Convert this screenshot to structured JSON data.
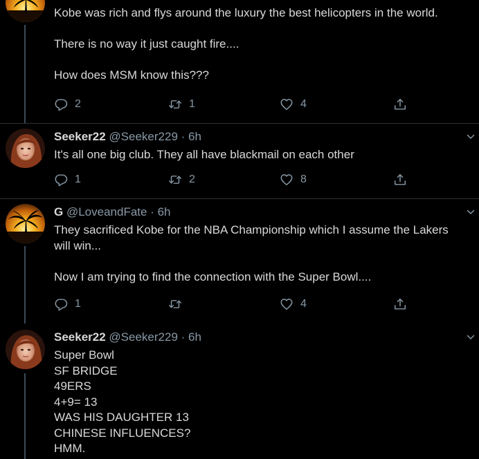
{
  "tweets": [
    {
      "name": "",
      "handle": "",
      "time": "",
      "avatar": "palm-sunset",
      "lines": [
        "Kobe was rich and flys around the luxury the best helicopters in the world.",
        "",
        "There is no way it just caught fire....",
        "",
        "How does MSM know this???"
      ],
      "replies": "2",
      "retweets": "1",
      "likes": "4"
    },
    {
      "name": "Seeker22",
      "handle": "@Seeker229 · 6h",
      "time": "6h",
      "avatar": "redhead-woman",
      "lines": [
        "It's all one big club. They all have blackmail on each other"
      ],
      "replies": "1",
      "retweets": "2",
      "likes": "8"
    },
    {
      "name": "G",
      "handle": "@LoveandFate · 6h",
      "time": "6h",
      "avatar": "palm-sunset",
      "lines": [
        "They sacrificed Kobe for the NBA Championship which I assume the Lakers",
        "will win...",
        "",
        "Now I am trying to find the connection with the Super Bowl...."
      ],
      "replies": "1",
      "retweets": "",
      "likes": "4"
    },
    {
      "name": "Seeker22",
      "handle": "@Seeker229 · 6h",
      "time": "6h",
      "avatar": "redhead-woman",
      "lines": [
        "Super Bowl",
        "SF BRIDGE",
        "49ERS",
        "4+9= 13",
        "WAS HIS DAUGHTER 13",
        "CHINESE INFLUENCES?",
        "HMM."
      ]
    }
  ],
  "colors": {
    "background": "#000000",
    "text": "#d9d9d9",
    "muted": "#8899a6",
    "separator": "#2f3336",
    "thread": "#3d4b5a"
  }
}
